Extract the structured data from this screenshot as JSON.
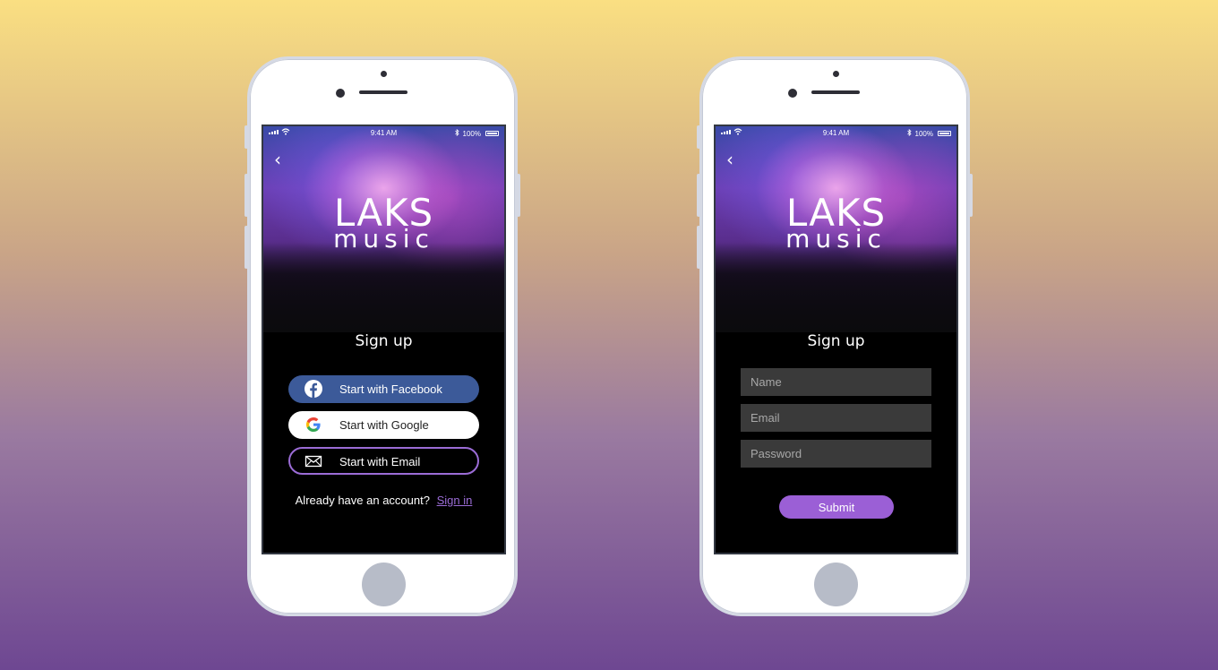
{
  "status_bar": {
    "time": "9:41 AM",
    "battery": "100%"
  },
  "logo": {
    "line1": "LAKS",
    "line2": "music"
  },
  "signup_options_screen": {
    "title": "Sign up",
    "facebook_label": "Start with Facebook",
    "google_label": "Start with Google",
    "email_label": "Start with Email",
    "already_text": "Already have an account?",
    "signin_link": "Sign in"
  },
  "signup_form_screen": {
    "title": "Sign up",
    "name_placeholder": "Name",
    "email_placeholder": "Email",
    "password_placeholder": "Password",
    "submit_label": "Submit"
  },
  "colors": {
    "facebook": "#3c5a99",
    "accent": "#9b6cd6",
    "field_bg": "#3a3a3a"
  },
  "icons": [
    "back-arrow-icon",
    "facebook-icon",
    "google-icon",
    "mail-icon",
    "wifi-icon",
    "bluetooth-icon",
    "battery-icon",
    "signal-icon"
  ]
}
